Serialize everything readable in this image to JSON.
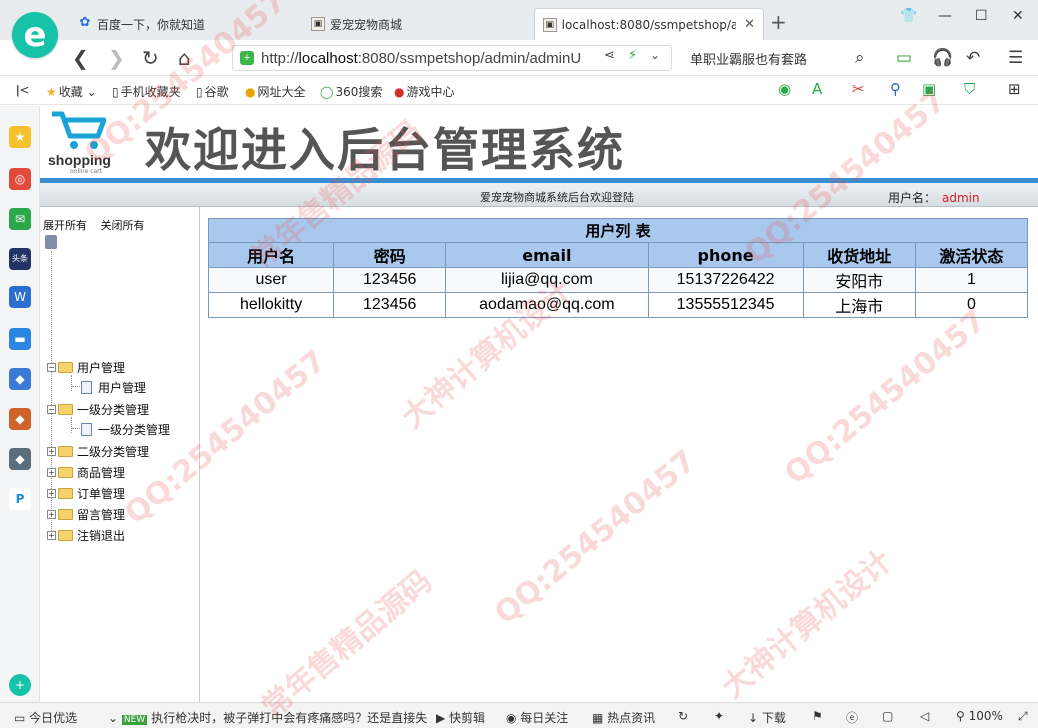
{
  "browser": {
    "tabs": [
      {
        "label": "百度一下，你就知道"
      },
      {
        "label": "爱宠宠物商城"
      },
      {
        "label": "localhost:8080/ssmpetshop/a"
      }
    ],
    "url_prefix": "http://",
    "url_host": "localhost",
    "url_rest": ":8080/ssmpetshop/admin/adminU",
    "search_hint": "单职业霸服也有套路",
    "bookmarks": [
      "收藏",
      "手机收藏夹",
      "谷歌",
      "网址大全",
      "360搜索",
      "游戏中心"
    ],
    "status": {
      "today": "今日优选",
      "news": "执行枪决时，被子弹打中会有疼痛感吗？还是直接失",
      "clip": "快剪辑",
      "daily": "每日关注",
      "hot": "热点资讯",
      "download": "下载",
      "zoom": "100%"
    }
  },
  "page": {
    "logo_word": "shopping",
    "logo_sub": "online cart",
    "title": "欢迎进入后台管理系统",
    "welcome": "爱宠宠物商城系统后台欢迎登陆",
    "user_label": "用户名：",
    "user_name": "admin"
  },
  "tree": {
    "expand_all": "展开所有",
    "collapse_all": "关闭所有",
    "nodes": [
      {
        "label": "用户管理"
      },
      {
        "label": "用户管理"
      },
      {
        "label": "一级分类管理"
      },
      {
        "label": "一级分类管理"
      },
      {
        "label": "二级分类管理"
      },
      {
        "label": "商品管理"
      },
      {
        "label": "订单管理"
      },
      {
        "label": "留言管理"
      },
      {
        "label": "注销退出"
      }
    ]
  },
  "table": {
    "caption": "用户列 表",
    "headers": [
      "用户名",
      "密码",
      "email",
      "phone",
      "收货地址",
      "激活状态"
    ],
    "rows": [
      [
        "user",
        "123456",
        "lijia@qq.com",
        "15137226422",
        "安阳市",
        "1"
      ],
      [
        "hellokitty",
        "123456",
        "aodamao@qq.com",
        "13555512345",
        "上海市",
        "0"
      ]
    ]
  },
  "watermark": [
    "QQ:254540457",
    "常年售精品源码",
    "大神计算机设计"
  ]
}
